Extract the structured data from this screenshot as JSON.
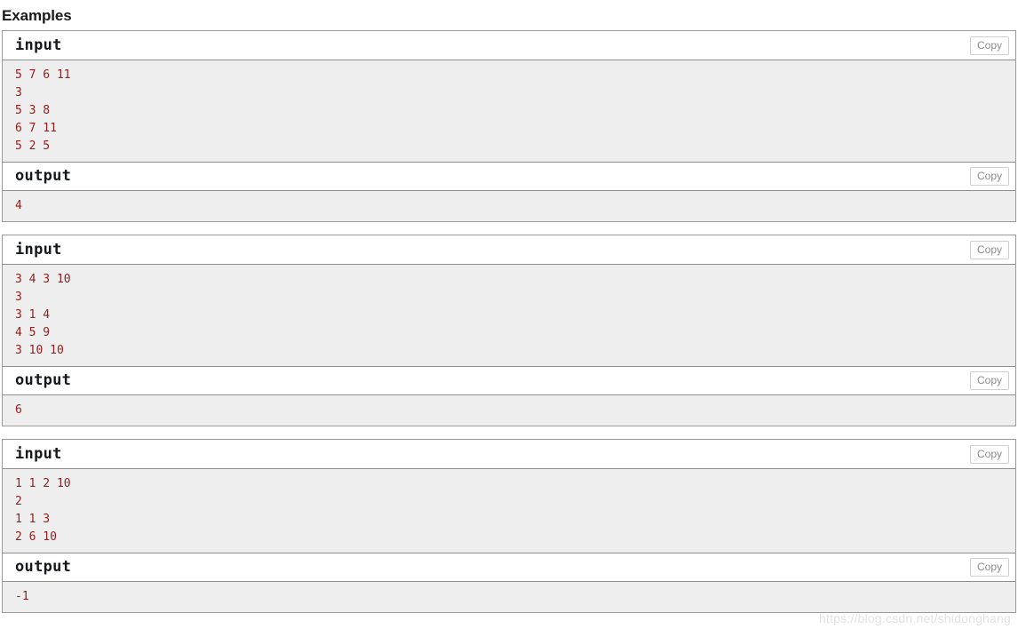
{
  "page": {
    "title": "Examples",
    "watermark": "https://blog.csdn.net/shidonghang",
    "copy_label": "Copy",
    "input_label": "input",
    "output_label": "output"
  },
  "examples": [
    {
      "input_label": "input",
      "input_copy_label": "Copy",
      "input_lines": [
        "5 7 6 11",
        "3",
        "5 3 8",
        "6 7 11",
        "5 2 5"
      ],
      "output_label": "output",
      "output_copy_label": "Copy",
      "output_lines": [
        "4"
      ]
    },
    {
      "input_label": "input",
      "input_copy_label": "Copy",
      "input_lines": [
        "3 4 3 10",
        "3",
        "3 1 4",
        "4 5 9",
        "3 10 10"
      ],
      "output_label": "output",
      "output_copy_label": "Copy",
      "output_lines": [
        "6"
      ]
    },
    {
      "input_label": "input",
      "input_copy_label": "Copy",
      "input_lines": [
        "1 1 2 10",
        "2",
        "1 1 3",
        "2 6 10"
      ],
      "output_label": "output",
      "output_copy_label": "Copy",
      "output_lines": [
        "-1"
      ]
    }
  ]
}
